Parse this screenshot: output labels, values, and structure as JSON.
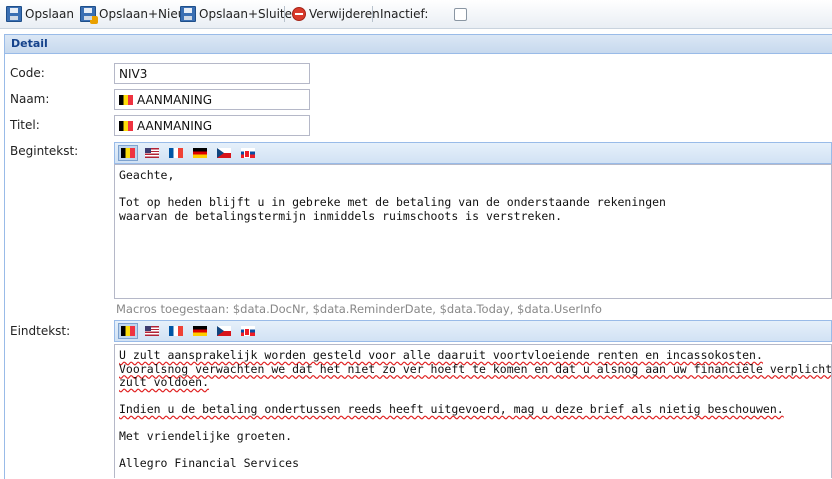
{
  "toolbar": {
    "save_label": "Opslaan",
    "save_new_label": "Opslaan+Nieuw",
    "save_close_label": "Opslaan+Sluiten",
    "delete_label": "Verwijderen",
    "inactive_label": "Inactief:",
    "inactive_checked": false
  },
  "panel": {
    "title": "Detail"
  },
  "form": {
    "code_label": "Code:",
    "code_value": "NIV3",
    "name_label": "Naam:",
    "name_value": "AANMANING",
    "title_label": "Titel:",
    "title_value": "AANMANING",
    "begintekst_label": "Begintekst:",
    "eindtekst_label": "Eindtekst:",
    "macros_text": "Macros toegestaan: $data.DocNr, $data.ReminderDate, $data.Today, $data.UserInfo"
  },
  "languages": [
    "be-nl",
    "en-us",
    "fr",
    "de",
    "cz",
    "sk"
  ],
  "begintekst": {
    "line1": "Geachte,",
    "line2": "",
    "line3": "Tot op heden blijft u in gebreke met de betaling van de onderstaande rekeningen",
    "line4": "waarvan de betalingstermijn inmiddels ruimschoots is verstreken."
  },
  "eindtekst": {
    "line1": "U zult aansprakelijk worden gesteld voor alle daaruit voortvloeiende renten en incassokosten.",
    "line2": "Vooralsnog verwachten we dat het niet zo ver hoeft te komen en dat u alsnog aan uw financiële verplichtingen",
    "line3": "zult voldoen.",
    "line4": "",
    "line5": "Indien u de betaling ondertussen reeds heeft uitgevoerd, mag u deze brief als nietig beschouwen.",
    "line6": "",
    "line7": "Met vriendelijke groeten.",
    "line8": "",
    "line9": "Allegro Financial Services"
  }
}
